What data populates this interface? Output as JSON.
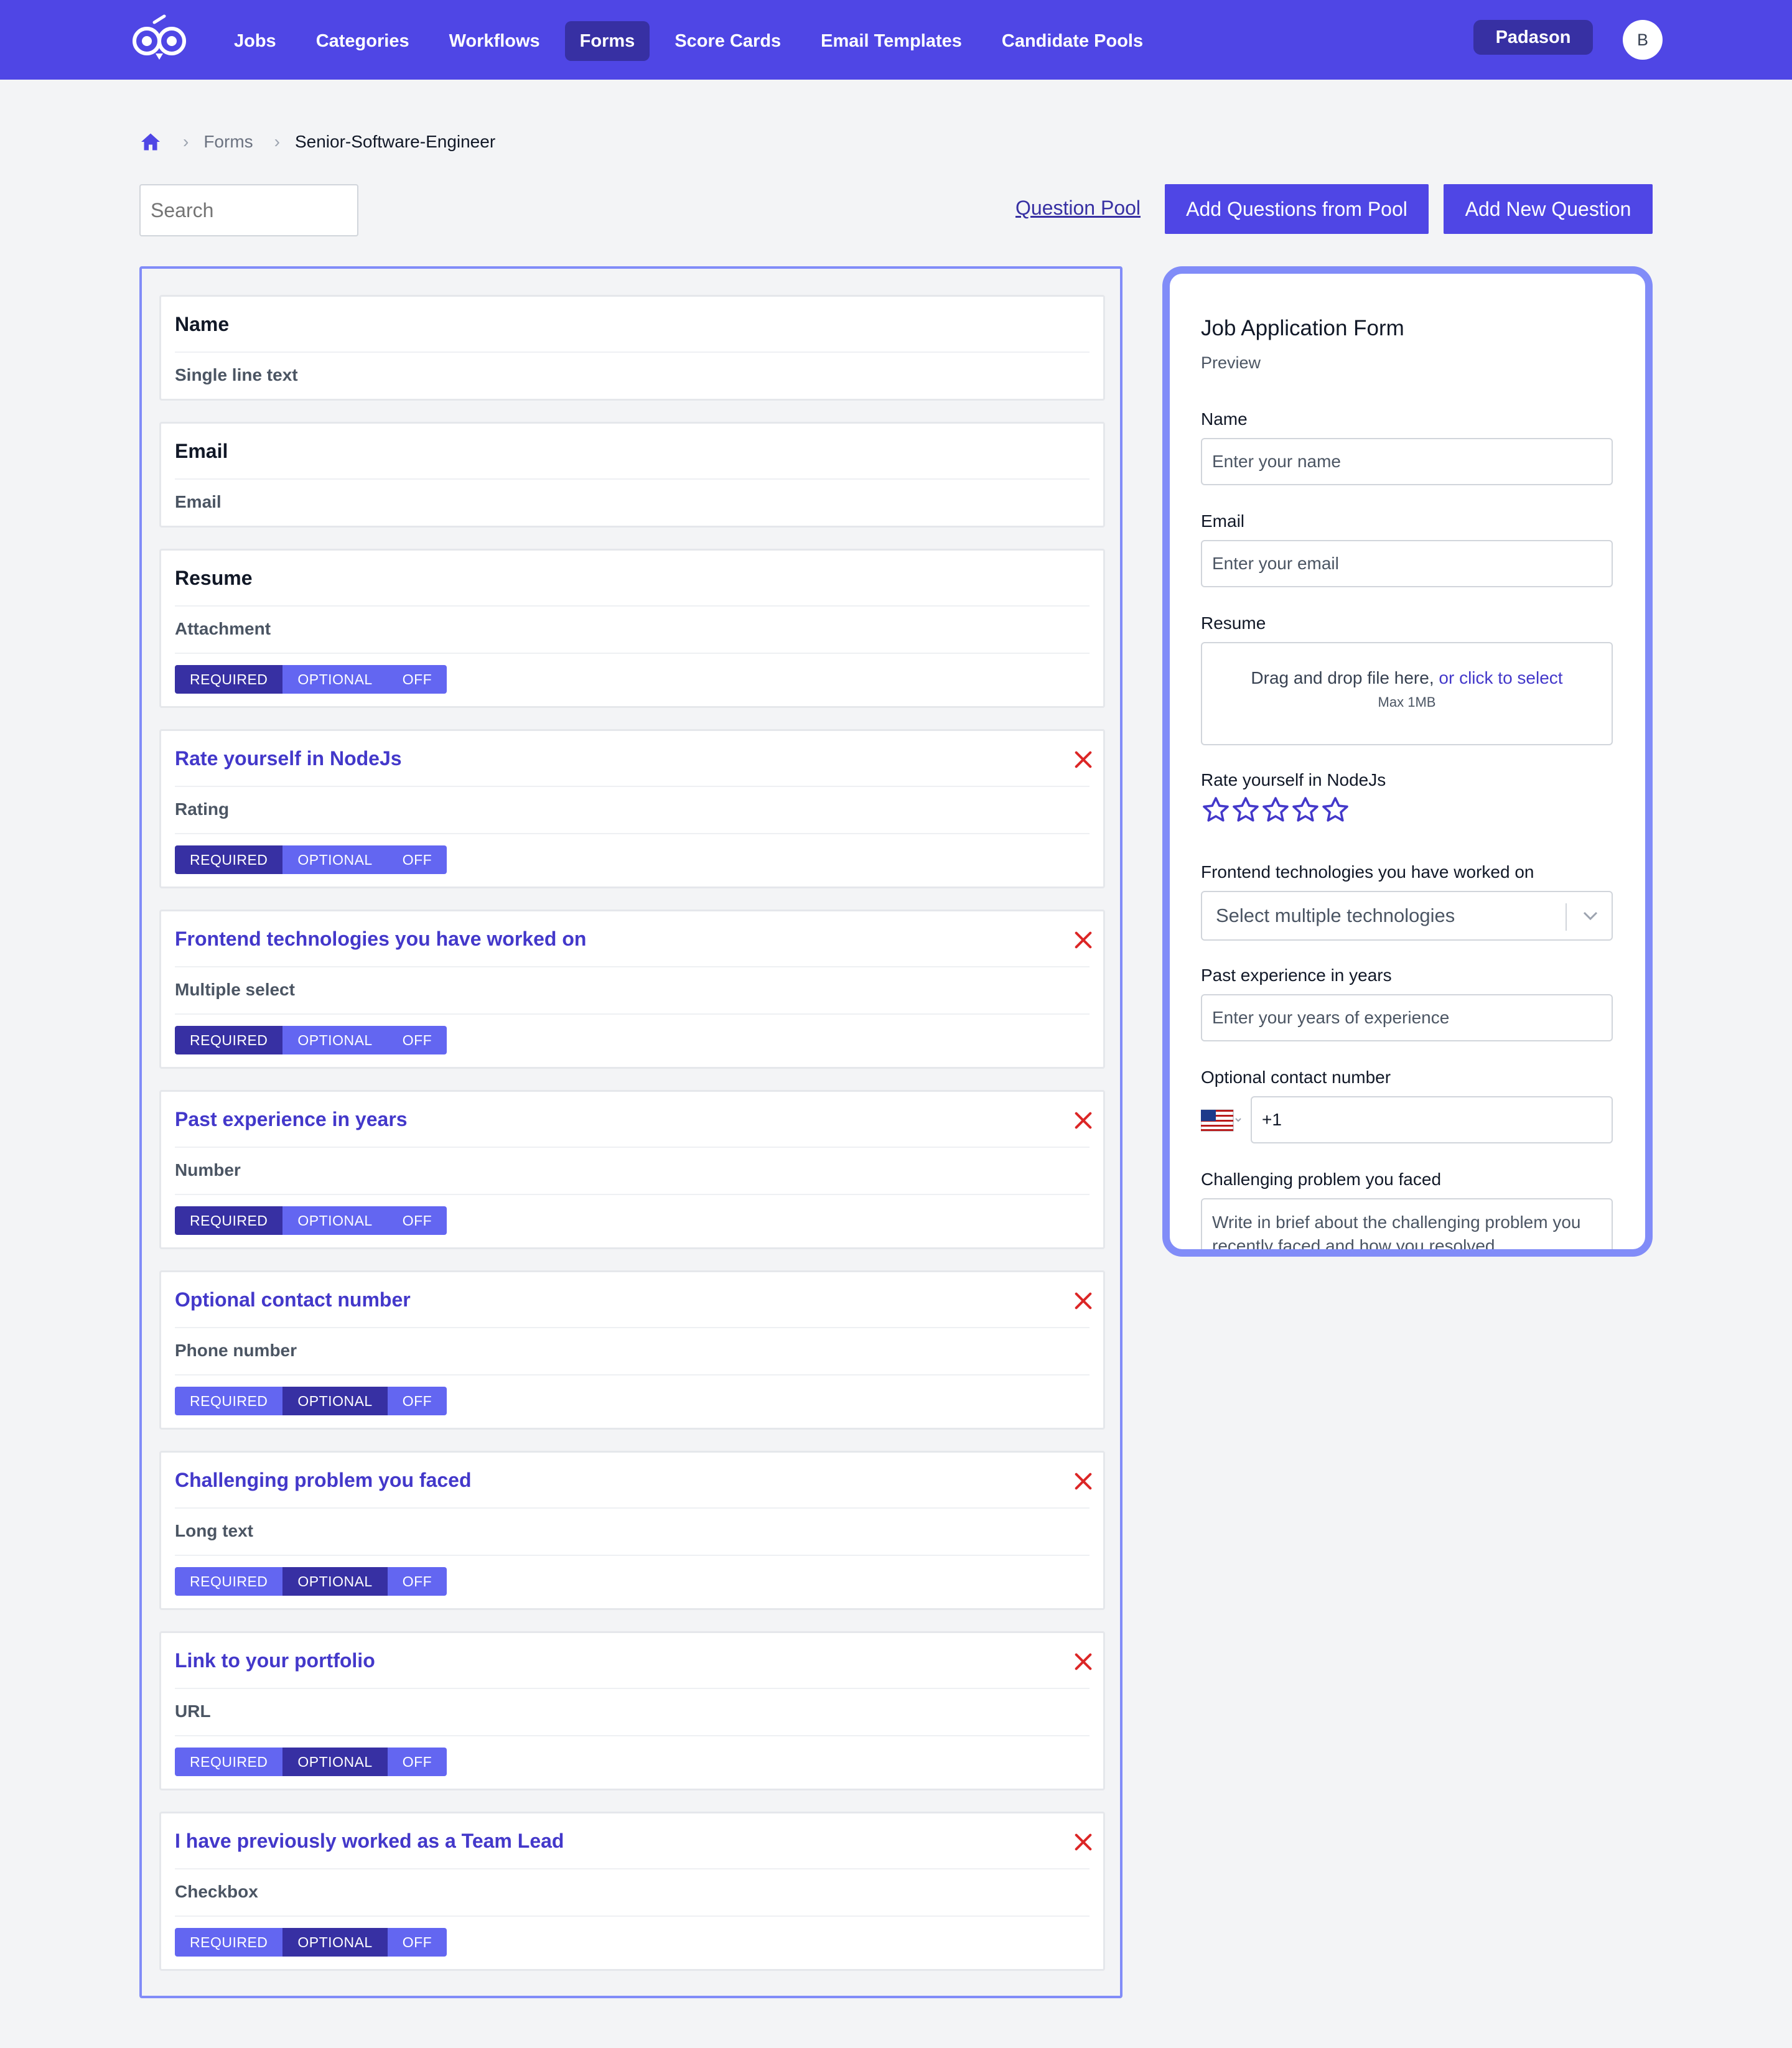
{
  "nav": {
    "links": [
      "Jobs",
      "Categories",
      "Workflows",
      "Forms",
      "Score Cards",
      "Email Templates",
      "Candidate Pools"
    ],
    "active": "Forms",
    "org": "Padason",
    "avatar": "B"
  },
  "breadcrumb": {
    "home_icon": "home-icon",
    "items": [
      "Forms",
      "Senior-Software-Engineer"
    ]
  },
  "toolbar": {
    "search_placeholder": "Search",
    "question_pool": "Question Pool",
    "add_from_pool": "Add Questions from Pool",
    "add_new": "Add New Question"
  },
  "segment": {
    "required": "REQUIRED",
    "optional": "OPTIONAL",
    "off": "OFF"
  },
  "questions": [
    {
      "title": "Name",
      "type": "Single line text"
    },
    {
      "title": "Email",
      "type": "Email"
    },
    {
      "title": "Resume",
      "type": "Attachment",
      "state": "required"
    },
    {
      "title": "Rate yourself in NodeJs",
      "type": "Rating",
      "state": "required"
    },
    {
      "title": "Frontend technologies you have worked on",
      "type": "Multiple select",
      "state": "required"
    },
    {
      "title": "Past experience in years",
      "type": "Number",
      "state": "required"
    },
    {
      "title": "Optional contact number",
      "type": "Phone number",
      "state": "optional"
    },
    {
      "title": "Challenging problem you faced",
      "type": "Long text",
      "state": "optional"
    },
    {
      "title": "Link to your portfolio",
      "type": "URL",
      "state": "optional"
    },
    {
      "title": "I have previously worked as a Team Lead",
      "type": "Checkbox",
      "state": "optional"
    }
  ],
  "preview": {
    "title": "Job Application Form",
    "subtitle": "Preview",
    "name_label": "Name",
    "name_placeholder": "Enter your name",
    "email_label": "Email",
    "email_placeholder": "Enter your email",
    "resume_label": "Resume",
    "drop_text": "Drag and drop file here,",
    "drop_link": "or click to select",
    "drop_max": "Max 1MB",
    "rating_label": "Rate yourself in NodeJs",
    "rating_stars": 5,
    "tech_label": "Frontend technologies you have worked on",
    "tech_placeholder": "Select multiple technologies",
    "exp_label": "Past experience in years",
    "exp_placeholder": "Enter your years of experience",
    "phone_label": "Optional contact number",
    "phone_value": "+1",
    "problem_label": "Challenging problem you faced",
    "problem_placeholder": "Write in brief about the challenging problem you recently faced and how you resolved"
  },
  "colors": {
    "brand": "#4f46e5",
    "brand_dark": "#3730a3",
    "danger": "#dc2626"
  }
}
